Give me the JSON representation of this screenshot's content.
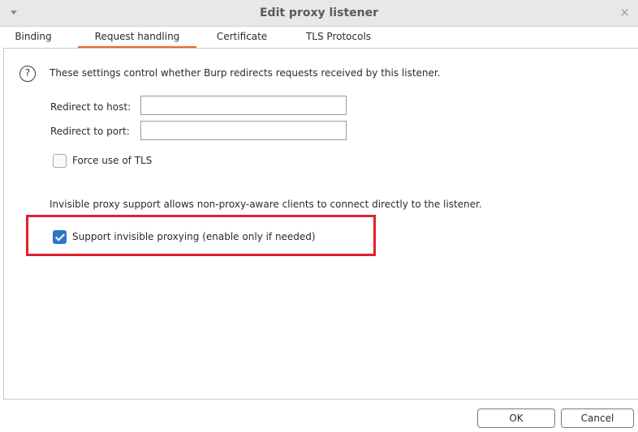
{
  "window": {
    "title": "Edit proxy listener",
    "close_symbol": "×"
  },
  "tabs": [
    {
      "label": "Binding",
      "active": false
    },
    {
      "label": "Request handling",
      "active": true
    },
    {
      "label": "Certificate",
      "active": false
    },
    {
      "label": "TLS Protocols",
      "active": false
    }
  ],
  "content": {
    "help_symbol": "?",
    "description": "These settings control whether Burp redirects requests received by this listener.",
    "redirect_host_label": "Redirect to host:",
    "redirect_host_value": "",
    "redirect_port_label": "Redirect to port:",
    "redirect_port_value": "",
    "force_tls_label": "Force use of TLS",
    "force_tls_checked": false,
    "invisible_description": "Invisible proxy support allows non-proxy-aware clients to connect directly to the listener.",
    "invisible_label": "Support invisible proxying (enable only if needed)",
    "invisible_checked": true
  },
  "buttons": {
    "ok_label": "OK",
    "cancel_label": "Cancel"
  },
  "colors": {
    "accent_tab": "#e56b2a",
    "checkbox_checked": "#2e74c7",
    "highlight": "#e0202e"
  },
  "icons": [
    "menu-arrow-icon",
    "close-icon",
    "help-icon",
    "checkmark-icon"
  ]
}
